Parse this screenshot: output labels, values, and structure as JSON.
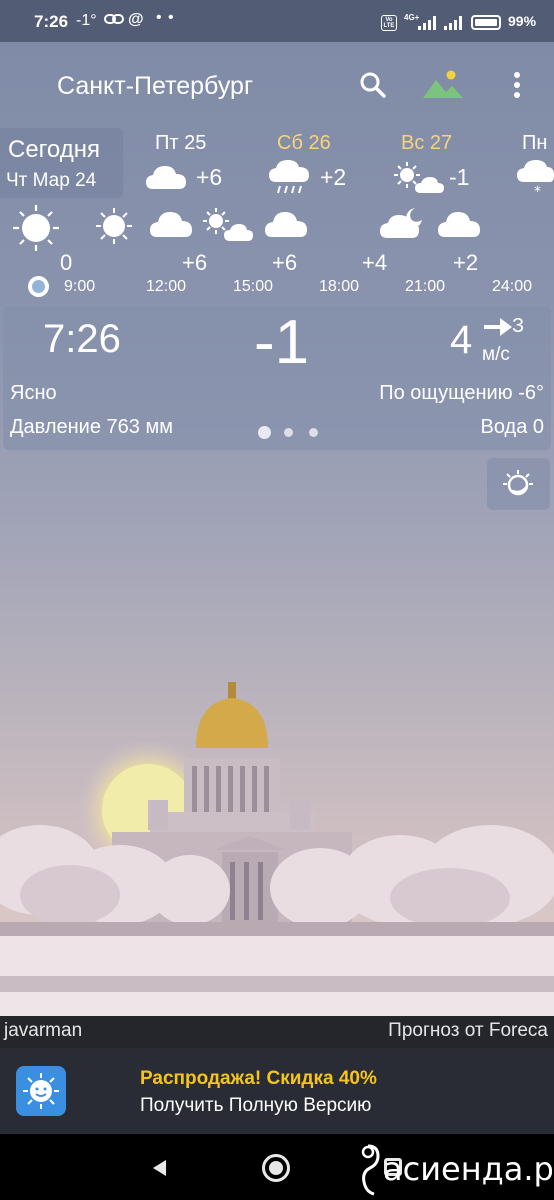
{
  "status_bar": {
    "time": "7:26",
    "temp": "-1°",
    "link_icon": "link-icon",
    "at_icon": "@",
    "dots": "• •",
    "volte": "Vo LTE",
    "network": "4G+",
    "battery_pct": "99%"
  },
  "header": {
    "city": "Санкт-Петербург",
    "search_icon": "search-icon",
    "scene_icon": "landscape-icon",
    "menu_icon": "more-vert-icon"
  },
  "days": {
    "today_label": "Сегодня",
    "today_date": "Чт Мар 24",
    "items": [
      {
        "name": "Пт 25",
        "temp": "+6",
        "icon": "cloud-icon",
        "weekend": false
      },
      {
        "name": "Сб 26",
        "temp": "+2",
        "icon": "rain-cloud-icon",
        "weekend": true
      },
      {
        "name": "Вс 27",
        "temp": "-1",
        "icon": "sun-cloud-icon",
        "weekend": true
      },
      {
        "name": "Пн",
        "temp": "",
        "icon": "snow-cloud-icon",
        "weekend": false
      }
    ]
  },
  "hourly": {
    "temps": [
      "0",
      "+6",
      "+6",
      "+4",
      "+2"
    ],
    "times": [
      "9:00",
      "12:00",
      "15:00",
      "18:00",
      "21:00",
      "24:00"
    ]
  },
  "current": {
    "time": "7:26",
    "temp": "-1",
    "wind_speed": "4",
    "wind_dir": "З",
    "wind_unit": "м/с",
    "condition": "Ясно",
    "feels_like": "По ощущению -6°",
    "pressure": "Давление 763 мм",
    "water": "Вода 0"
  },
  "credits": {
    "photo_author": "javarman",
    "forecast_by": "Прогноз от Foreca"
  },
  "promo": {
    "title": "Распродажа! Скидка 40%",
    "subtitle": "Получить Полную Версию"
  },
  "watermark": "асиенда.ру",
  "colors": {
    "status_bar": "#525d75",
    "weekend": "#f6d47a",
    "promo_title": "#f5c518",
    "promo_bg": "#2a2c35"
  }
}
